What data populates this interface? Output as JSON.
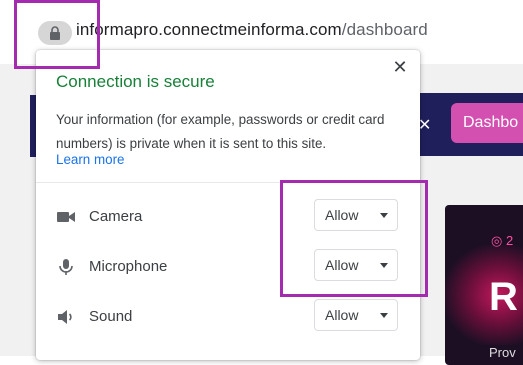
{
  "address_bar": {
    "domain": "informapro.connectmeinforma.com",
    "path": "/dashboard",
    "lock_icon": "lock-icon"
  },
  "background_page": {
    "dashboard_button_label": "Dashbo",
    "card_big_text": "R",
    "card_top_text": "2",
    "card_bottom_text": "Prov"
  },
  "popup": {
    "title": "Connection is secure",
    "description": "Your information (for example, passwords or credit card numbers) is private when it is sent to this site.",
    "learn_more": "Learn more",
    "close_icon": "close-icon",
    "permissions": [
      {
        "label": "Camera",
        "value": "Allow",
        "icon": "camera-icon"
      },
      {
        "label": "Microphone",
        "value": "Allow",
        "icon": "microphone-icon"
      },
      {
        "label": "Sound",
        "value": "Allow",
        "icon": "speaker-icon"
      }
    ]
  },
  "colors": {
    "secure_green": "#188038",
    "link_blue": "#1a73e8",
    "highlight_purple": "#a42bb0",
    "navy": "#1f1f5c",
    "pink_button": "#d34fb0"
  }
}
